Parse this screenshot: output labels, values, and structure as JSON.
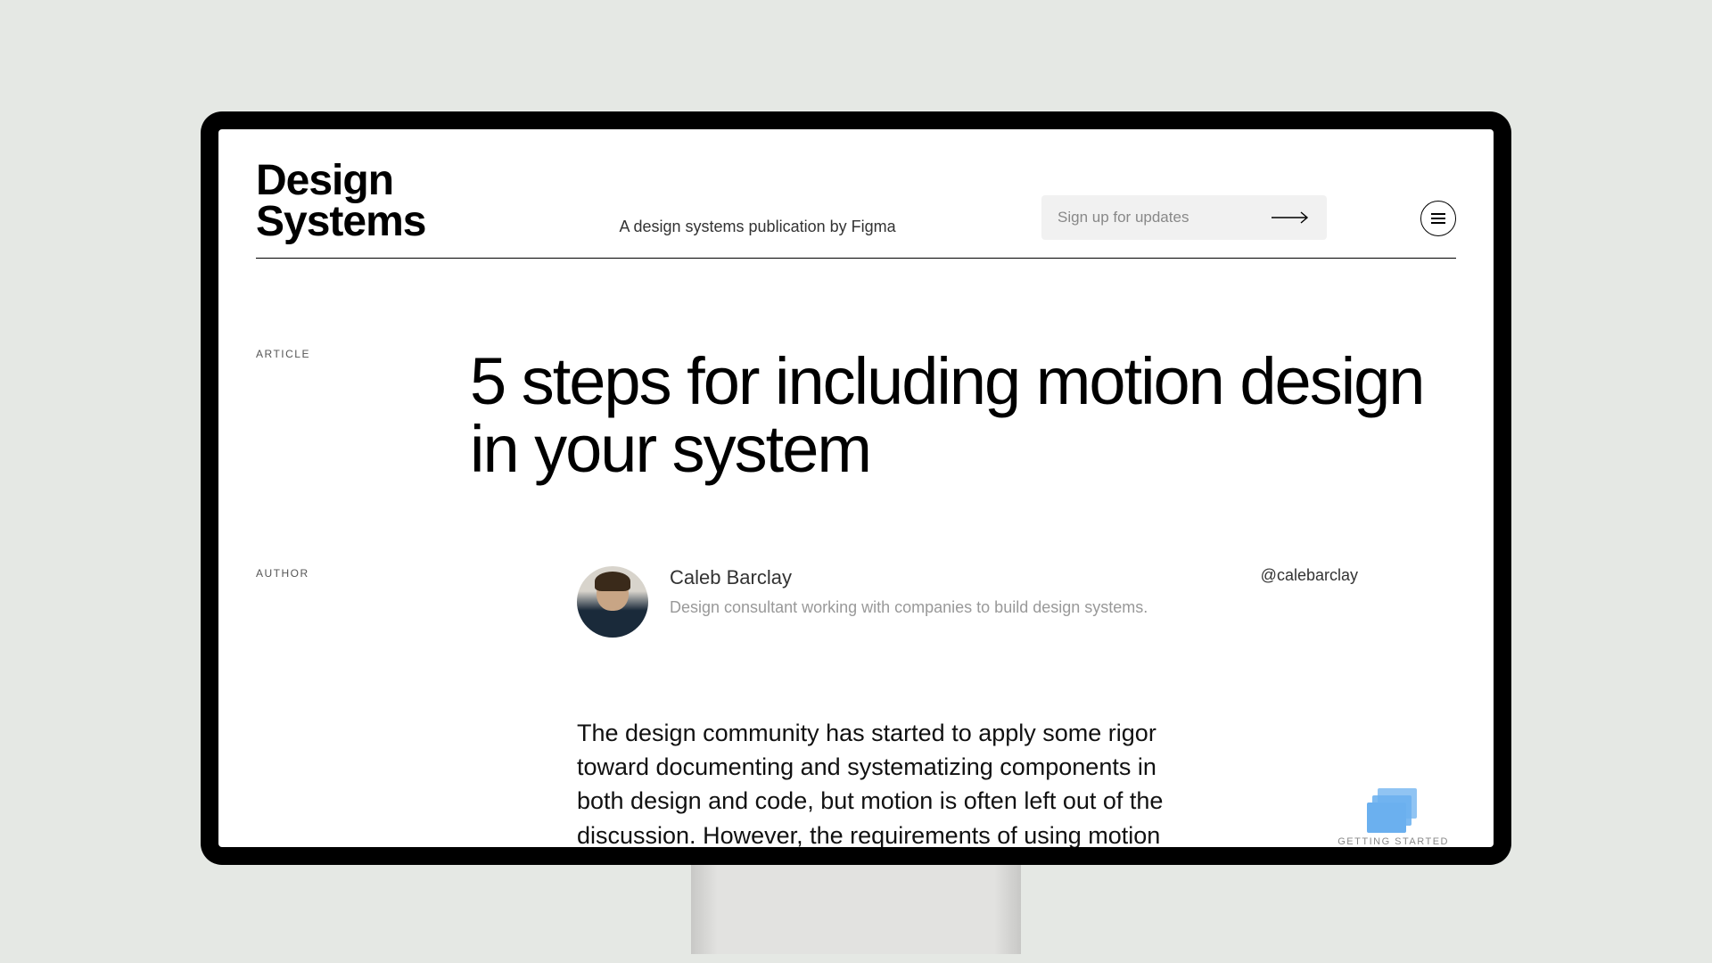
{
  "header": {
    "logo_line1": "Design",
    "logo_line2": "Systems",
    "tagline": "A design systems publication by Figma",
    "signup_placeholder": "Sign up for updates"
  },
  "labels": {
    "article": "ARTICLE",
    "author": "AUTHOR"
  },
  "article": {
    "title": "5 steps for including motion design in your system",
    "body": "The design community has started to apply some rigor toward documenting and systematizing components in both design and code, but motion is often left out of the discussion. However, the requirements of using motion"
  },
  "author": {
    "name": "Caleb Barclay",
    "bio": "Design consultant working with companies to build design systems.",
    "handle": "@calebarclay"
  },
  "badge": {
    "label": "GETTING STARTED"
  }
}
